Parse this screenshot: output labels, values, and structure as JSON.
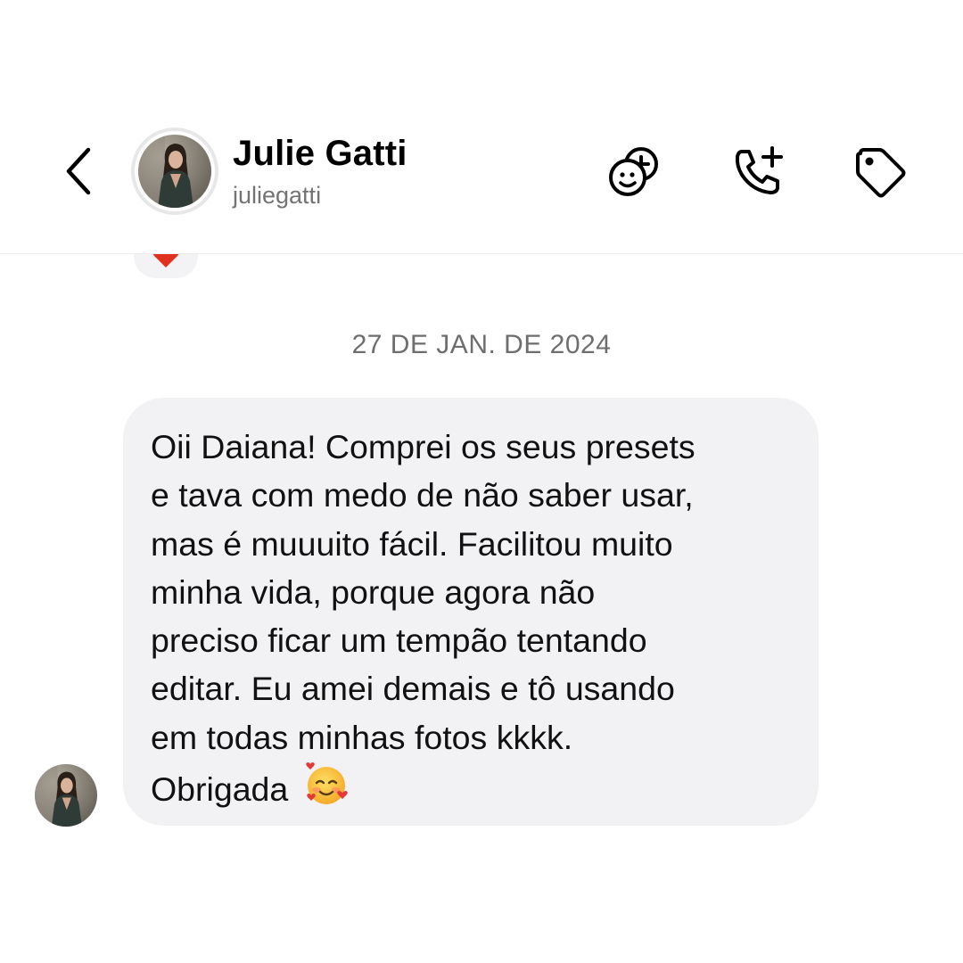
{
  "header": {
    "contact_name": "Julie Gatti",
    "contact_handle": "juliegatti",
    "icons": [
      "back-chevron-icon",
      "avatar",
      "add-sticker-icon",
      "add-call-icon",
      "tag-icon"
    ]
  },
  "reaction": {
    "emoji_icon": "heart-icon",
    "color": "#e0301e"
  },
  "date_separator": "27 DE JAN. DE 2024",
  "message": {
    "lines": [
      "Oii Daiana! Comprei os seus presets",
      "e tava com medo de não saber usar,",
      "mas é muuuito fácil. Facilitou muito",
      "minha vida, porque agora não",
      "preciso ficar um tempão tentando",
      "editar. Eu amei demais e tô usando",
      "em todas minhas fotos kkkk.",
      "Obrigada"
    ],
    "trailing_emoji": "smiling-face-with-hearts-icon",
    "bubble_color": "#f2f2f4"
  }
}
